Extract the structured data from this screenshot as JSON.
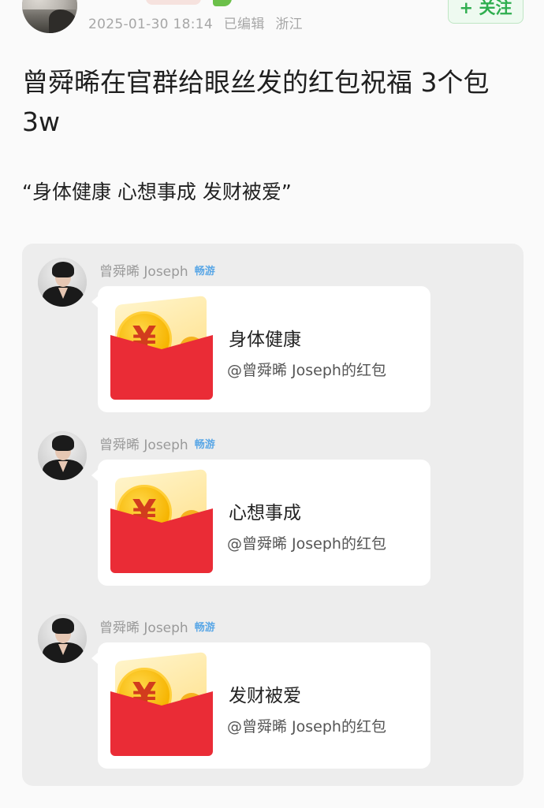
{
  "header": {
    "timestamp": "2025-01-30 18:14",
    "edited": "已编辑",
    "location": "浙江",
    "follow_label": "+ 关注"
  },
  "post": {
    "title": "曾舜晞在官群给眼丝发的红包祝福 3个包3w",
    "quote": "“身体健康 心想事成 发财被爱”"
  },
  "chat": {
    "messages": [
      {
        "sender": "曾舜晞 Joseph",
        "tag": "畅游",
        "wish": "身体健康",
        "from": "@曾舜晞 Joseph的红包"
      },
      {
        "sender": "曾舜晞 Joseph",
        "tag": "畅游",
        "wish": "心想事成",
        "from": "@曾舜晞 Joseph的红包"
      },
      {
        "sender": "曾舜晞 Joseph",
        "tag": "畅游",
        "wish": "发财被爱",
        "from": "@曾舜晞 Joseph的红包"
      }
    ],
    "coin_symbol": "¥"
  },
  "colors": {
    "accent_green": "#2fae4f",
    "envelope_red": "#ea2c36",
    "coin_gold": "#f6b400",
    "tag_blue": "#5aa7e6"
  }
}
